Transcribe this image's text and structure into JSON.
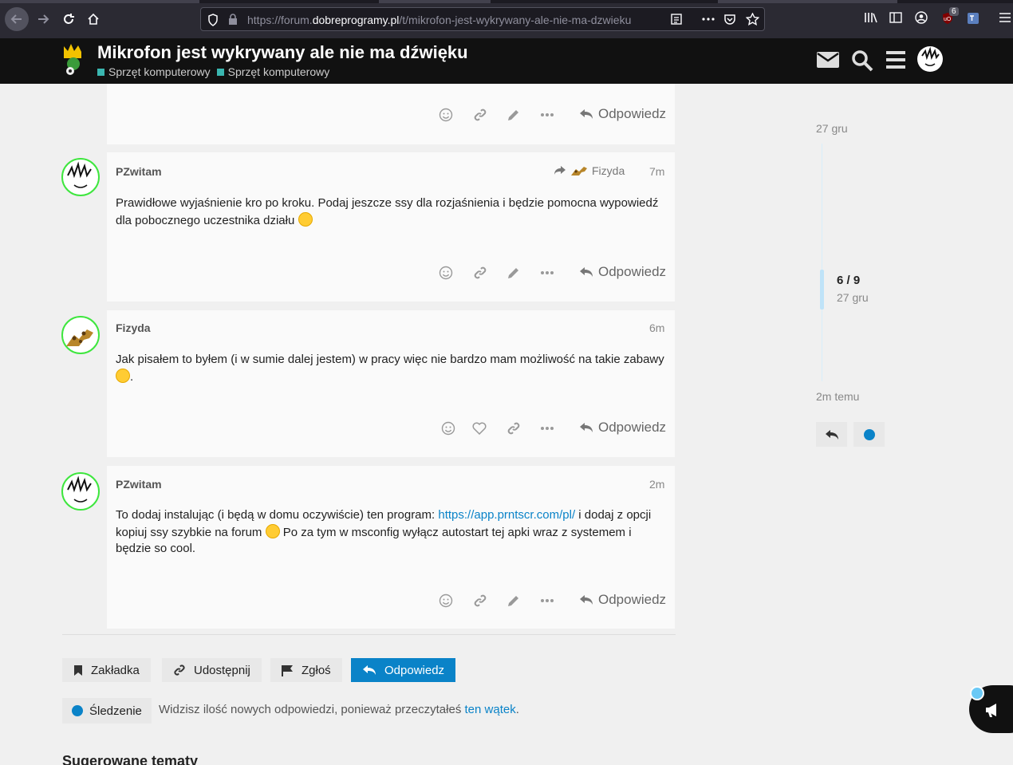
{
  "browser": {
    "url_prefix": "https://forum.",
    "url_domain": "dobreprogramy.pl",
    "url_path": "/t/mikrofon-jest-wykrywany-ale-nie-ma-dzwieku",
    "badge_count": "6"
  },
  "header": {
    "topic_title": "Mikrofon jest wykrywany ale nie ma dźwięku",
    "categories": [
      "Sprzęt komputerowy",
      "Sprzęt komputerowy"
    ]
  },
  "actions": {
    "reply_label": "Odpowiedz"
  },
  "posts": [
    {
      "username": "PZwitam",
      "reply_to": "Fizyda",
      "time": "7m",
      "body": "Prawidłowe wyjaśnienie kro po kroku. Podaj jeszcze ssy dla rozjaśnienia i będzie pomocna wypowiedź dla pobocznego uczestnika działu"
    },
    {
      "username": "Fizyda",
      "time": "6m",
      "body": "Jak pisałem to byłem (i w sumie dalej jestem) w pracy więc nie bardzo mam możliwość na takie zabawy",
      "body_end": "."
    },
    {
      "username": "PZwitam",
      "time": "2m",
      "body_start": "To dodaj instalując (i będą w domu oczywiście) ten program: ",
      "link": "https://app.prntscr.com/pl/",
      "body_mid": " i dodaj z opcji kopiuj ssy szybkie na forum",
      "body_end": " Po za tym w msconfig wyłącz autostart tej apki wraz z systemem i będzie so cool."
    }
  ],
  "footer": {
    "bookmark": "Zakładka",
    "share": "Udostępnij",
    "flag": "Zgłoś",
    "reply": "Odpowiedz",
    "tracking": "Śledzenie",
    "notif_text": "Widzisz ilość nowych odpowiedzi, ponieważ przeczytałeś ",
    "notif_link": "ten wątek",
    "notif_end": ".",
    "suggested": "Sugerowane tematy"
  },
  "timeline": {
    "start_date": "27 gru",
    "position": "6 / 9",
    "position_date": "27 gru",
    "end_date": "2m temu"
  },
  "colors": {
    "accent": "#0a83c8",
    "category": "#3ab6b0",
    "avatar_ring": "#3ee63e"
  }
}
